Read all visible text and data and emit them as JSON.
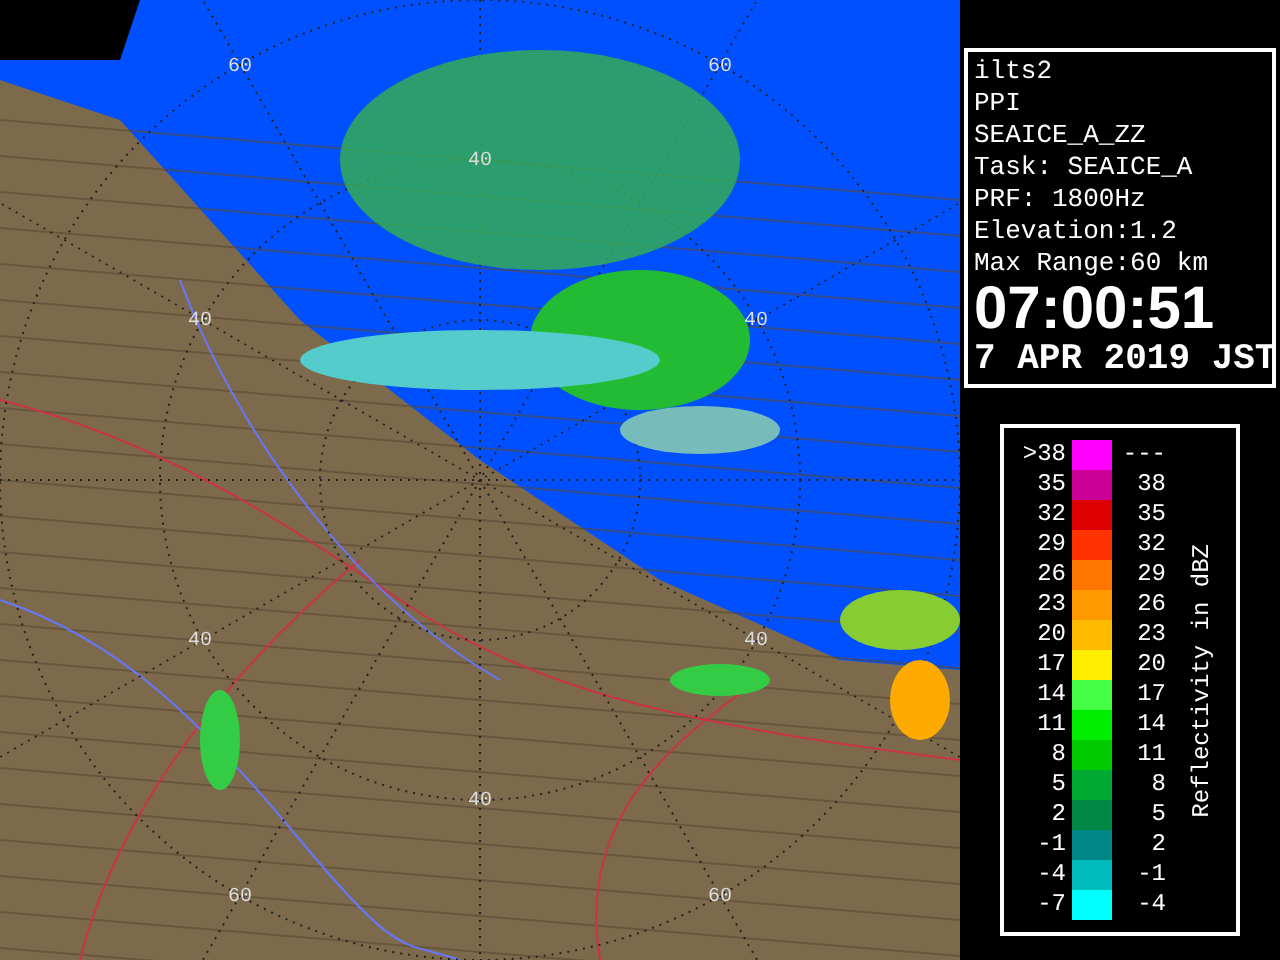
{
  "map": {
    "range_labels": [
      "60",
      "60",
      "40",
      "40",
      "40",
      "40",
      "40",
      "40",
      "60",
      "60"
    ]
  },
  "info": {
    "lines": [
      "ilts2",
      "PPI",
      "SEAICE_A_ZZ",
      "Task: SEAICE_A",
      "PRF: 1800Hz",
      "Elevation:1.2",
      "Max Range:60 km"
    ],
    "time": "07:00:51",
    "date": "7 APR 2019 JST"
  },
  "legend": {
    "title": "Reflectivity in dBZ",
    "rows": [
      {
        "low": ">38",
        "high": "---",
        "color": "#ff00ff"
      },
      {
        "low": "35",
        "high": "38",
        "color": "#cc0099"
      },
      {
        "low": "32",
        "high": "35",
        "color": "#dd0000"
      },
      {
        "low": "29",
        "high": "32",
        "color": "#ff3300"
      },
      {
        "low": "26",
        "high": "29",
        "color": "#ff7700"
      },
      {
        "low": "23",
        "high": "26",
        "color": "#ff9900"
      },
      {
        "low": "20",
        "high": "23",
        "color": "#ffbb00"
      },
      {
        "low": "17",
        "high": "20",
        "color": "#ffee00"
      },
      {
        "low": "14",
        "high": "17",
        "color": "#44ff44"
      },
      {
        "low": "11",
        "high": "14",
        "color": "#00ee00"
      },
      {
        "low": "8",
        "high": "11",
        "color": "#00cc00"
      },
      {
        "low": "5",
        "high": "8",
        "color": "#00aa33"
      },
      {
        "low": "2",
        "high": "5",
        "color": "#008844"
      },
      {
        "low": "-1",
        "high": "2",
        "color": "#008888"
      },
      {
        "low": "-4",
        "high": "-1",
        "color": "#00bbbb"
      },
      {
        "low": "-7",
        "high": "-4",
        "color": "#00ffff"
      }
    ]
  }
}
